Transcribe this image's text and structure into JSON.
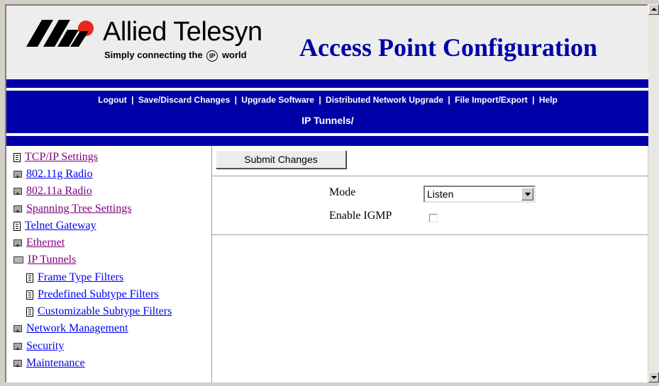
{
  "header": {
    "brand_name": "Allied Telesyn",
    "tagline_before": "Simply connecting the",
    "tagline_ip": "IP",
    "tagline_after": "world",
    "app_title": "Access Point Configuration"
  },
  "nav": {
    "links": [
      {
        "label": "Logout"
      },
      {
        "label": "Save/Discard Changes"
      },
      {
        "label": "Upgrade Software"
      },
      {
        "label": "Distributed Network Upgrade"
      },
      {
        "label": "File Import/Export"
      },
      {
        "label": "Help"
      }
    ],
    "separator": "|",
    "section_title": "IP Tunnels/"
  },
  "sidebar": {
    "items": [
      {
        "label": "TCP/IP Settings",
        "icon": "document-icon",
        "visited": true
      },
      {
        "label": "802.11g Radio",
        "icon": "folder-closed-icon",
        "visited": false
      },
      {
        "label": "802.11a Radio",
        "icon": "folder-closed-icon",
        "visited": true
      },
      {
        "label": "Spanning Tree Settings",
        "icon": "folder-closed-icon",
        "visited": true
      },
      {
        "label": "Telnet Gateway",
        "icon": "document-icon",
        "visited": false
      },
      {
        "label": "Ethernet",
        "icon": "folder-closed-icon",
        "visited": true
      },
      {
        "label": "IP Tunnels",
        "icon": "folder-open-icon",
        "visited": true
      },
      {
        "label": "Frame Type Filters",
        "icon": "document-icon",
        "visited": false
      },
      {
        "label": "Predefined Subtype Filters",
        "icon": "document-icon",
        "visited": false
      },
      {
        "label": "Customizable Subtype Filters",
        "icon": "document-icon",
        "visited": false
      },
      {
        "label": "Network Management",
        "icon": "folder-closed-icon",
        "visited": false
      },
      {
        "label": "Security",
        "icon": "folder-closed-icon",
        "visited": false
      },
      {
        "label": "Maintenance",
        "icon": "folder-closed-icon",
        "visited": false
      }
    ]
  },
  "main": {
    "submit_label": "Submit Changes",
    "mode_label": "Mode",
    "mode_value": "Listen",
    "igmp_label": "Enable IGMP",
    "igmp_checked": false
  },
  "colors": {
    "nav_bar": "#0000a8",
    "title_blue": "#0000a8",
    "link_visited": "#800080",
    "link_normal": "#0000ee",
    "logo_red": "#e8281c"
  }
}
